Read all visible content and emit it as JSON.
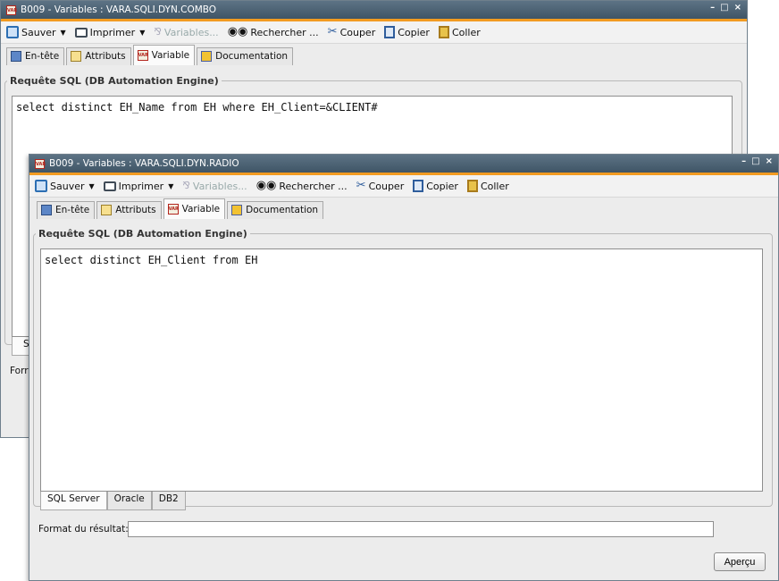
{
  "back_window": {
    "title": "B009 - Variables : VARA.SQLI.DYN.COMBO",
    "toolbar": {
      "save": "Sauver",
      "print": "Imprimer",
      "variables": "Variables...",
      "search": "Rechercher ...",
      "cut": "Couper",
      "copy": "Copier",
      "paste": "Coller"
    },
    "tabs": [
      "En-tête",
      "Attributs",
      "Variable",
      "Documentation"
    ],
    "group_title": "Requête SQL (DB Automation Engine)",
    "sql": "select distinct EH_Name from EH where EH_Client=&CLIENT#",
    "peek_tab": "S",
    "peek_format": "Forr"
  },
  "front_window": {
    "title": "B009 - Variables : VARA.SQLI.DYN.RADIO",
    "toolbar": {
      "save": "Sauver",
      "print": "Imprimer",
      "variables": "Variables...",
      "search": "Rechercher ...",
      "cut": "Couper",
      "copy": "Copier",
      "paste": "Coller"
    },
    "tabs": [
      "En-tête",
      "Attributs",
      "Variable",
      "Documentation"
    ],
    "group_title": "Requête SQL (DB Automation Engine)",
    "sql": "select distinct EH_Client from EH",
    "db_tabs": [
      "SQL Server",
      "Oracle",
      "DB2"
    ],
    "format_label": "Format du résultat:",
    "format_value": "",
    "preview_button": "Aperçu"
  },
  "icons": {
    "app": "var-icon",
    "save": "save-icon",
    "print": "printer-icon",
    "variables": "variables-icon",
    "search": "binoculars-icon",
    "cut": "scissors-icon",
    "copy": "copy-icon",
    "paste": "paste-icon"
  },
  "colors": {
    "titlebar": "#4b6071",
    "accent": "#f29b21",
    "window_bg": "#ececec"
  }
}
